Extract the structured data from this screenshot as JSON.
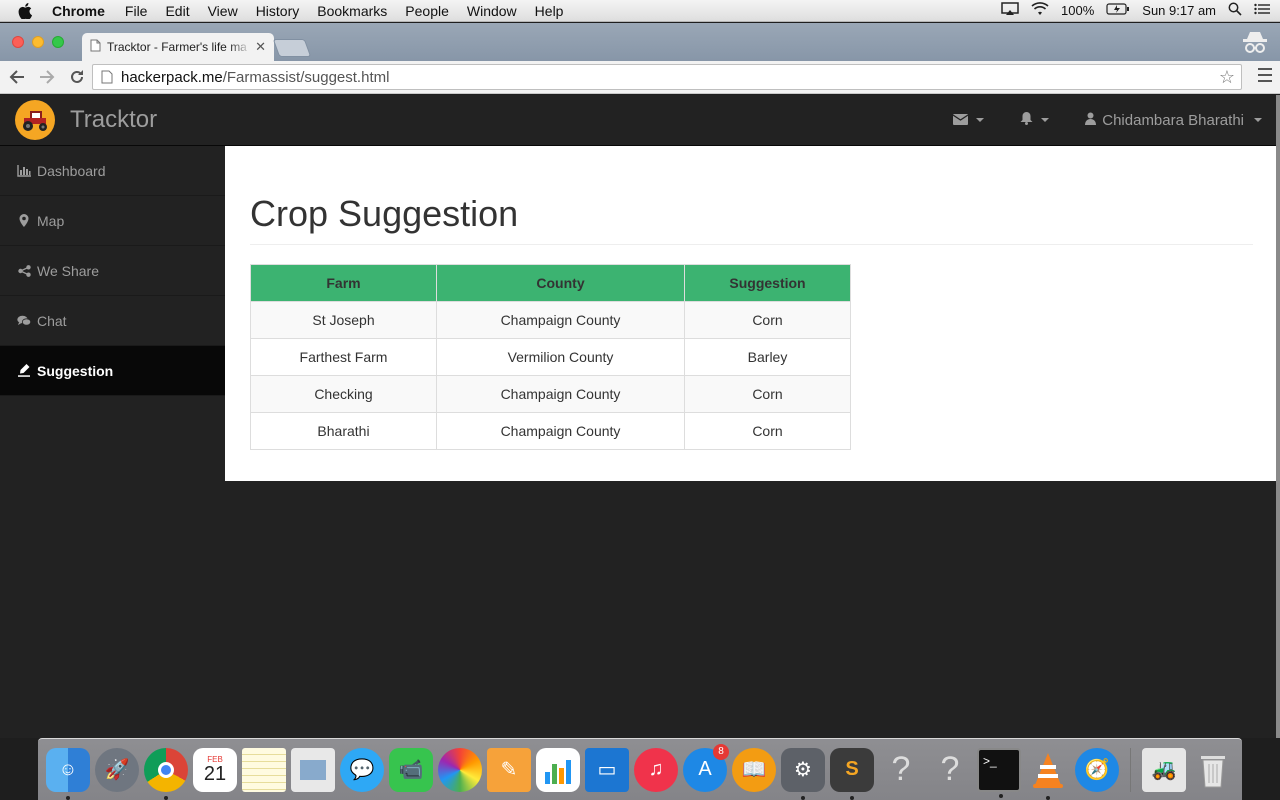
{
  "menubar": {
    "app": "Chrome",
    "items": [
      "File",
      "Edit",
      "View",
      "History",
      "Bookmarks",
      "People",
      "Window",
      "Help"
    ],
    "battery": "100%",
    "clock": "Sun 9:17 am"
  },
  "browser": {
    "tab_title": "Tracktor - Farmer's life ma",
    "url_host": "hackerpack.me",
    "url_path": "/Farmassist/suggest.html"
  },
  "app": {
    "brand": "Tracktor",
    "user_name": "Chidambara Bharathi",
    "sidebar": [
      {
        "label": "Dashboard",
        "icon": "bar-chart-icon"
      },
      {
        "label": "Map",
        "icon": "map-marker-icon"
      },
      {
        "label": "We Share",
        "icon": "share-icon"
      },
      {
        "label": "Chat",
        "icon": "comments-icon"
      },
      {
        "label": "Suggestion",
        "icon": "pencil-icon",
        "active": true
      }
    ],
    "page_title": "Crop Suggestion",
    "table": {
      "headers": [
        "Farm",
        "County",
        "Suggestion"
      ],
      "rows": [
        [
          "St Joseph",
          "Champaign County",
          "Corn"
        ],
        [
          "Farthest Farm",
          "Vermilion County",
          "Barley"
        ],
        [
          "Checking",
          "Champaign County",
          "Corn"
        ],
        [
          "Bharathi",
          "Champaign County",
          "Corn"
        ]
      ]
    },
    "accent_color": "#3cb371"
  },
  "dock": {
    "apps": [
      "finder",
      "launchpad",
      "chrome",
      "calendar",
      "notes",
      "preview",
      "messages",
      "facetime",
      "photos",
      "pages",
      "numbers",
      "keynote",
      "itunes",
      "app-store",
      "ibooks",
      "system-preferences",
      "sublime-text",
      "unknown",
      "unknown",
      "terminal",
      "vlc",
      "safari",
      "tracktor",
      "trash"
    ],
    "calendar_month": "FEB",
    "calendar_day": "21",
    "app_store_badge": "8"
  }
}
